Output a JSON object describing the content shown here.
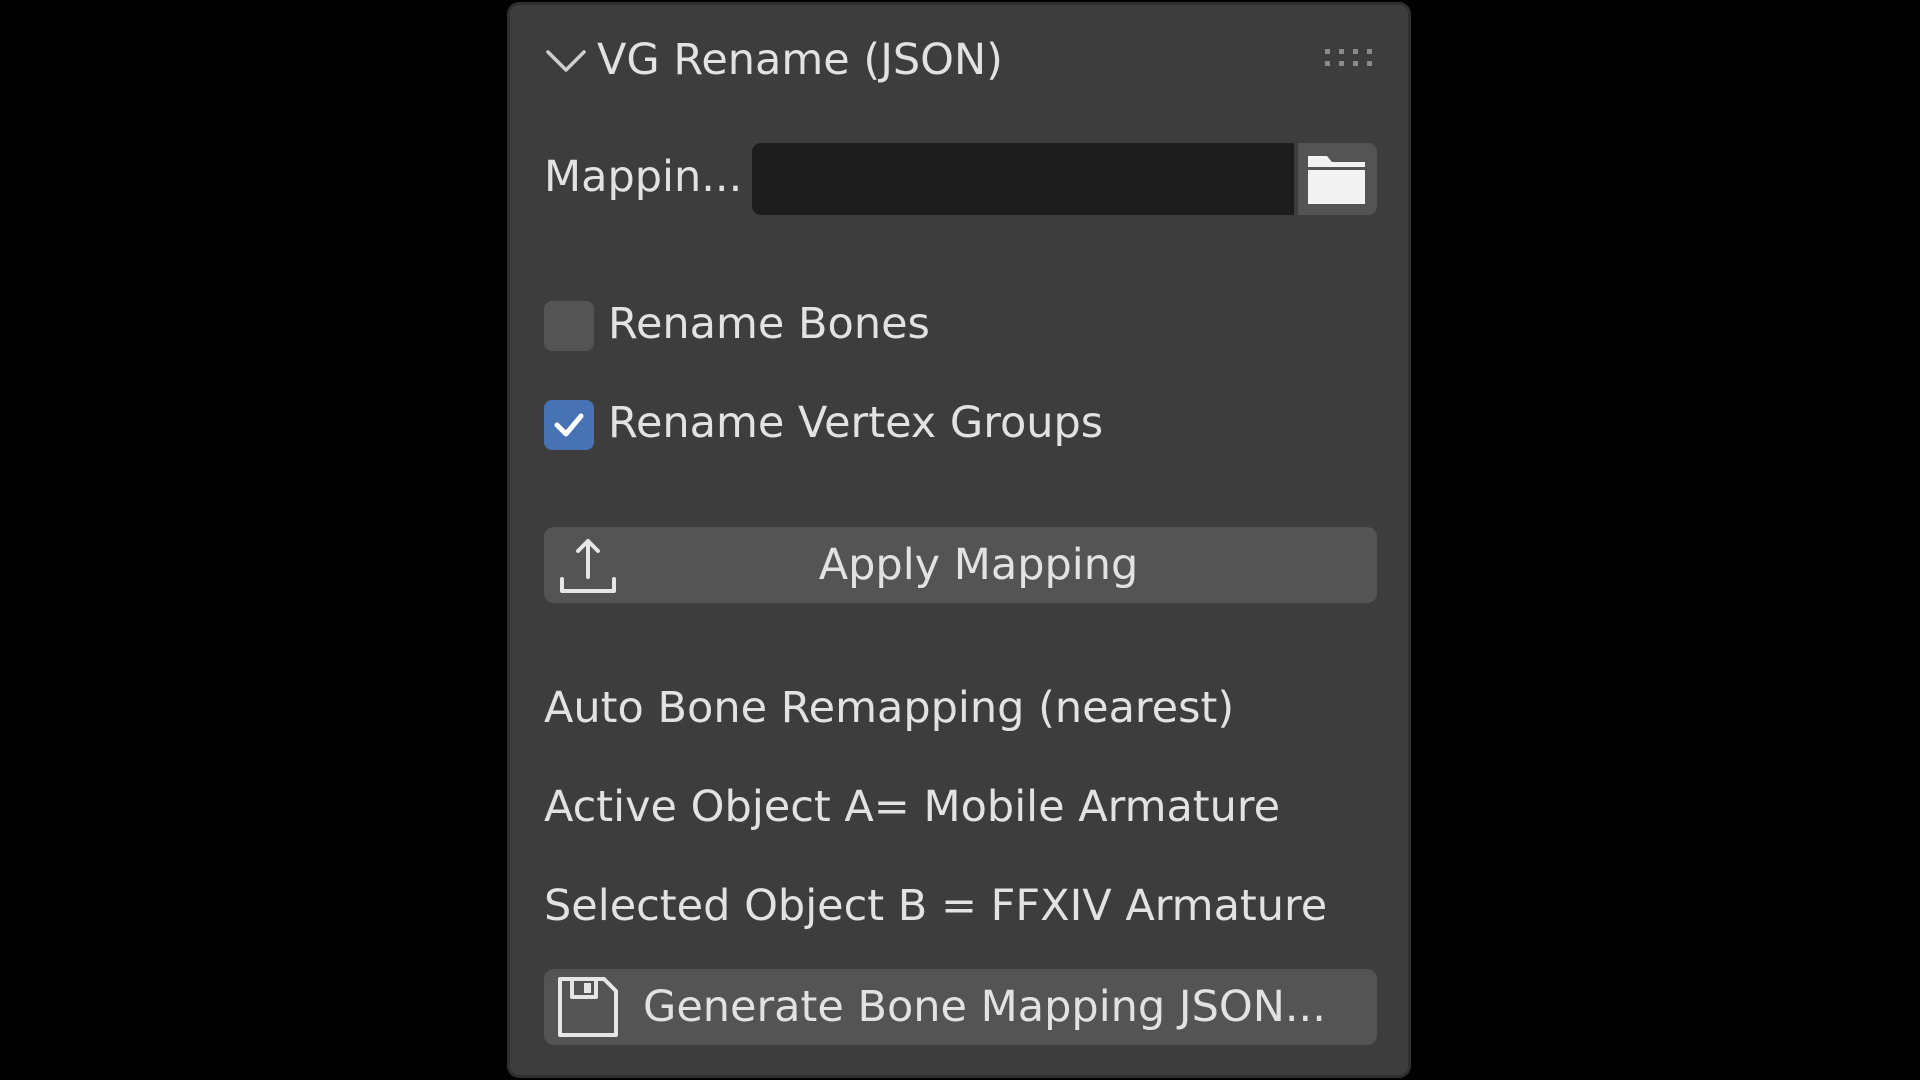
{
  "panel": {
    "title": "VG Rename (JSON)",
    "mapping_label": "Mappin...",
    "mapping_value": "",
    "rename_bones": {
      "label": "Rename Bones",
      "checked": false
    },
    "rename_vertex_groups": {
      "label": "Rename Vertex Groups",
      "checked": true
    },
    "apply_button_label": "Apply Mapping",
    "auto_section_title": "Auto Bone Remapping (nearest)",
    "active_object_line": "Active Object A= Mobile Armature",
    "selected_object_line": "Selected Object B = FFXIV Armature",
    "generate_button_label": "Generate Bone Mapping JSON..."
  },
  "icons": {
    "collapse": "chevron-down-icon",
    "drag": "drag-handle-icon",
    "folder": "folder-icon",
    "checkmark": "checkmark-icon",
    "export": "export-icon",
    "save": "floppy-disk-icon"
  },
  "colors": {
    "background": "#000000",
    "panel": "#3d3d3d",
    "field": "#1d1d1d",
    "button": "#545454",
    "accent": "#4772b3",
    "text": "#e2e2e2"
  }
}
